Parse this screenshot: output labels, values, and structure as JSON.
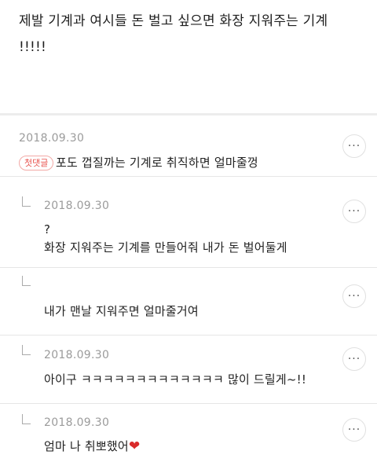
{
  "post": {
    "title_line1": "제발 기계과 여시들 돈 벌고 싶으면 화장 지워주는 기계",
    "title_line2": "!!!!!"
  },
  "comments": [
    {
      "date": "2018.09.30",
      "badge": "첫댓글",
      "text": "포도 껍질까는 기계로 취직하면 얼마줄껑",
      "is_reply": false
    },
    {
      "date": "2018.09.30",
      "text_line1": "?",
      "text_line2": "화장 지워주는 기계를 만들어줘 내가 돈 벌어둘게",
      "is_reply": true
    },
    {
      "text": "내가 맨날 지워주면 얼마줄거여",
      "is_reply": true
    },
    {
      "date": "2018.09.30",
      "text": "아이구 ㅋㅋㅋㅋㅋㅋㅋㅋㅋㅋㅋㅋㅋ 많이 드릴게~!!",
      "is_reply": true
    },
    {
      "date": "2018.09.30",
      "text": "엄마 나 취뽀했어",
      "emoji": "heart",
      "is_reply": true
    }
  ],
  "more_label": "···",
  "icons": {
    "more": "more-options-icon",
    "reply": "reply-arrow-icon",
    "heart": "heart-icon"
  },
  "colors": {
    "badge": "#e8544f",
    "heart": "#d92b2b",
    "date": "#9b9b9b"
  }
}
